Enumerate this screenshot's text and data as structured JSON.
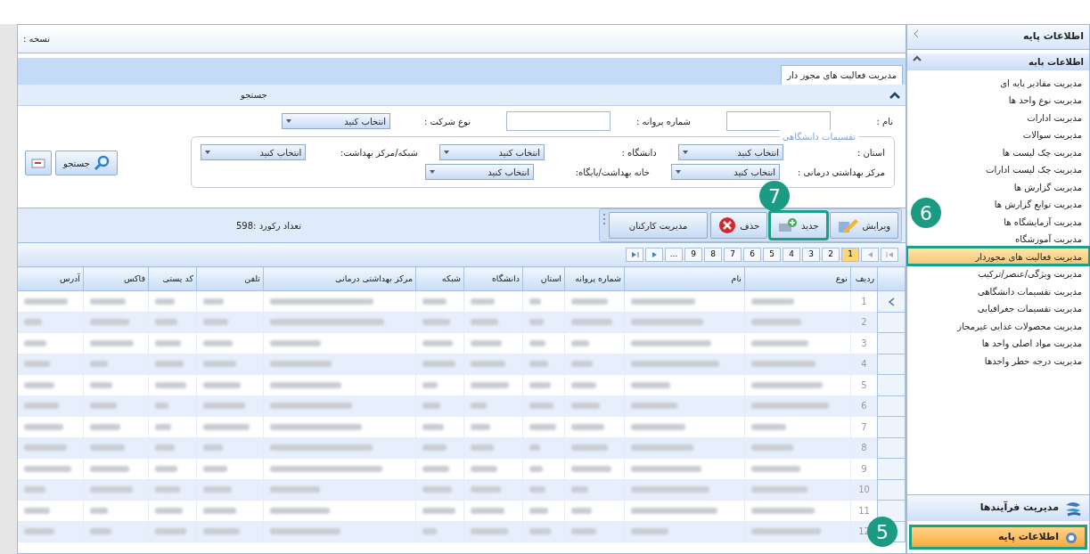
{
  "main": {
    "version_label": "نسخه :",
    "tab": {
      "label": "مدیریت فعالیت های مجوز دار",
      "selected": true
    },
    "search_panel": {
      "title": "جستجو",
      "expanded": true,
      "fields": [
        {
          "label": "نام :",
          "kind": "text"
        },
        {
          "label": "شماره پروانه :",
          "kind": "text"
        },
        {
          "label": "نوع شرکت :",
          "kind": "select",
          "value": "انتخاب کنید"
        }
      ],
      "group": {
        "title": "تقسیمات دانشگاهی",
        "rows": [
          [
            {
              "label": "استان :",
              "value": "انتخاب کنید"
            },
            {
              "label": "دانشگاه :",
              "value": "انتخاب کنید"
            },
            {
              "label": "شبکه/مرکز بهداشت:",
              "value": "انتخاب کنید"
            }
          ],
          [
            {
              "label": "مرکز بهداشتی درمانی :",
              "value": "انتخاب کنید"
            },
            {
              "label": "خانه بهداشت/پایگاه:",
              "value": "انتخاب کنید"
            }
          ]
        ]
      },
      "search_button": "جستجو"
    },
    "toolbar": {
      "buttons": [
        {
          "label": "ویرایش",
          "kind": "edit",
          "highlighted": false
        },
        {
          "label": "جدید",
          "kind": "add",
          "highlighted": true
        },
        {
          "label": "حذف",
          "kind": "delete",
          "highlighted": false
        },
        {
          "label": "مدیریت کارکنان",
          "kind": "plain",
          "highlighted": false
        }
      ],
      "record_count": "تعداد رکورد :598"
    },
    "pager": {
      "pages": [
        {
          "label": "1",
          "selected": true
        },
        {
          "label": "2",
          "selected": false
        },
        {
          "label": "3",
          "selected": false
        },
        {
          "label": "4",
          "selected": false
        },
        {
          "label": "5",
          "selected": false
        },
        {
          "label": "6",
          "selected": false
        },
        {
          "label": "7",
          "selected": false
        },
        {
          "label": "8",
          "selected": false
        },
        {
          "label": "9",
          "selected": false
        },
        {
          "label": "...",
          "selected": false
        }
      ]
    },
    "table": {
      "columns": [
        "ردیف",
        "نوع",
        "نام",
        "شماره پروانه",
        "استان",
        "دانشگاه",
        "شبکه",
        "مرکز بهداشتی درمانی",
        "تلفن",
        "کد پستی",
        "فاکس",
        "آدرس"
      ],
      "rows": [
        {
          "number": "1",
          "selected": true
        },
        {
          "number": "2",
          "selected": false
        },
        {
          "number": "3",
          "selected": false
        },
        {
          "number": "4",
          "selected": false
        },
        {
          "number": "5",
          "selected": false
        },
        {
          "number": "6",
          "selected": false
        },
        {
          "number": "7",
          "selected": false
        },
        {
          "number": "8",
          "selected": false
        },
        {
          "number": "9",
          "selected": false
        },
        {
          "number": "10",
          "selected": false
        },
        {
          "number": "11",
          "selected": false
        },
        {
          "number": "12",
          "selected": false
        }
      ]
    }
  },
  "sidebar": {
    "title": "اطلاعات پایه",
    "section": {
      "title": "اطلاعات پایه",
      "expanded": true,
      "items": [
        {
          "label": "مدیریت مقادیر پایه ای",
          "selected": false
        },
        {
          "label": "مدیریت نوع واحد ها",
          "selected": false
        },
        {
          "label": "مدیریت ادارات",
          "selected": false
        },
        {
          "label": "مدیریت سوالات",
          "selected": false
        },
        {
          "label": "مدیریت چک لیست ها",
          "selected": false
        },
        {
          "label": "مدیریت چک لیست ادارات",
          "selected": false
        },
        {
          "label": "مدیریت گزارش ها",
          "selected": false
        },
        {
          "label": "مدیریت توابع گزارش ها",
          "selected": false
        },
        {
          "label": "مدیریت آزمایشگاه ها",
          "selected": false
        },
        {
          "label": "مدیریت آموزشگاه",
          "selected": false
        },
        {
          "label": "مدیریت فعالیت های مجوردار",
          "selected": true
        },
        {
          "label": "مدیریت ویژگی/عنصر/ترکیب",
          "selected": false
        },
        {
          "label": "مدیریت تقسیمات دانشگاهی",
          "selected": false
        },
        {
          "label": "مدیریت تقسیمات جغرافیایی",
          "selected": false
        },
        {
          "label": "مدیریت محصولات غذایی غیرمجاز",
          "selected": false
        },
        {
          "label": "مدیریت مواد اصلی واحد ها",
          "selected": false
        },
        {
          "label": "مدیریت درجه خطر واحدها",
          "selected": false
        }
      ]
    },
    "bottom_items": [
      {
        "label": "مدیریت فرآیندها",
        "kind": "process",
        "selected": false
      },
      {
        "label": "اطلاعات پایه",
        "kind": "gear",
        "selected": true
      }
    ]
  },
  "callouts": [
    {
      "label": "7"
    },
    {
      "label": "6"
    },
    {
      "label": "5"
    }
  ]
}
